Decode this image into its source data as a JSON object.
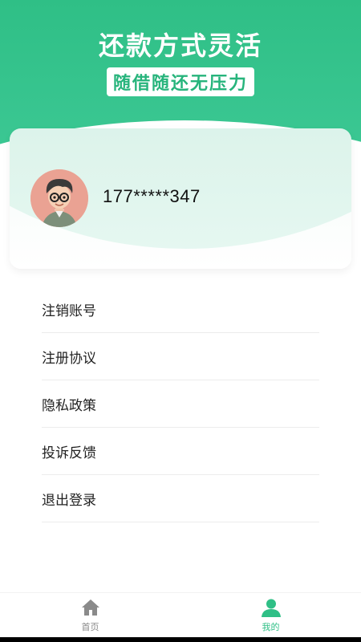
{
  "hero": {
    "headline": "还款方式灵活",
    "subline": "随借随还无压力"
  },
  "profile": {
    "phone": "177*****347",
    "avatar_icon": "cartoon-avatar-icon"
  },
  "menu": {
    "items": [
      {
        "label": "注销账号"
      },
      {
        "label": "注册协议"
      },
      {
        "label": "隐私政策"
      },
      {
        "label": "投诉反馈"
      },
      {
        "label": "退出登录"
      }
    ]
  },
  "tabs": {
    "home": {
      "label": "首页",
      "icon": "home-icon"
    },
    "mine": {
      "label": "我的",
      "icon": "user-icon",
      "active": true
    }
  },
  "colors": {
    "accent": "#2fbf86",
    "inactive": "#888888"
  }
}
